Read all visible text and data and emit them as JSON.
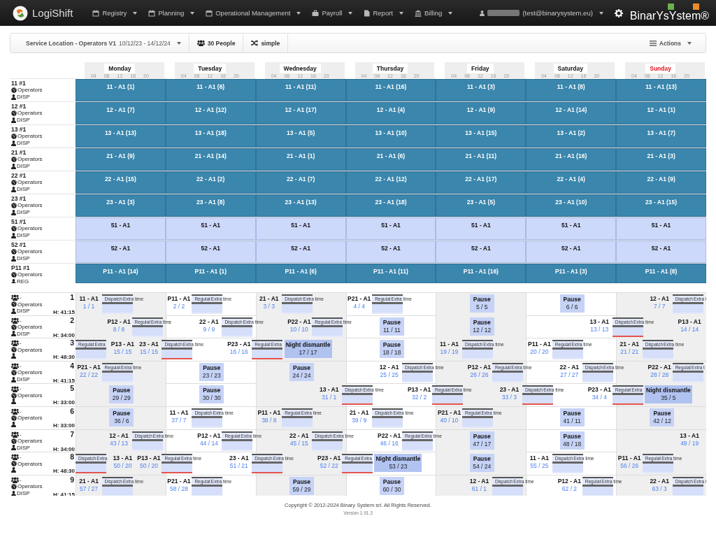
{
  "navbar": {
    "brand": "LogiShift",
    "menus": [
      {
        "label": "Registry",
        "kind": "calendar"
      },
      {
        "label": "Planning",
        "kind": "calendar"
      },
      {
        "label": "Operational Management",
        "kind": "calendar"
      },
      {
        "label": "Payroll",
        "kind": "briefcase"
      },
      {
        "label": "Report",
        "kind": "file"
      },
      {
        "label": "Billing",
        "kind": "bank"
      }
    ],
    "user_email": "(test@binarysystem.eu)",
    "company_logo": "BinarYsYstem®"
  },
  "toolbar": {
    "plan": "Service Location - Operators V1",
    "dates": "10/12/23 - 14/12/24",
    "people": "30 People",
    "mode": "simple",
    "actions": "Actions"
  },
  "days": [
    {
      "label": "Monday",
      "holiday": false,
      "ticks": [
        "04",
        "08",
        "12",
        "16",
        "20"
      ]
    },
    {
      "label": "Tuesday",
      "holiday": false,
      "ticks": [
        "04",
        "08",
        "12",
        "16",
        "20"
      ]
    },
    {
      "label": "Wednesday",
      "holiday": false,
      "ticks": [
        "04",
        "08",
        "12",
        "16",
        "20"
      ]
    },
    {
      "label": "Thursday",
      "holiday": false,
      "ticks": [
        "04",
        "08",
        "12",
        "16",
        "20"
      ]
    },
    {
      "label": "Friday",
      "holiday": false,
      "ticks": [
        "04",
        "08",
        "12",
        "16",
        "20"
      ]
    },
    {
      "label": "Saturday",
      "holiday": false,
      "ticks": [
        "04",
        "08",
        "12",
        "16",
        "20"
      ]
    },
    {
      "label": "Sunday",
      "holiday": true,
      "ticks": [
        "04",
        "08",
        "12",
        "16",
        "20"
      ]
    }
  ],
  "positions": [
    {
      "name": "11 #1",
      "group": "Operators",
      "role": "DISP",
      "cells": [
        {
          "text": "11 - A1 (1)",
          "assigned": true
        },
        {
          "text": "11 - A1 (6)",
          "assigned": true
        },
        {
          "text": "11 - A1 (11)",
          "assigned": true
        },
        {
          "text": "11 - A1 (16)",
          "assigned": true
        },
        {
          "text": "11 - A1 (3)",
          "assigned": true
        },
        {
          "text": "11 - A1 (8)",
          "assigned": true
        },
        {
          "text": "11 - A1 (13)",
          "assigned": true
        }
      ]
    },
    {
      "name": "12 #1",
      "group": "Operators",
      "role": "DISP",
      "cells": [
        {
          "text": "12 - A1 (7)",
          "assigned": true
        },
        {
          "text": "12 - A1 (12)",
          "assigned": true
        },
        {
          "text": "12 - A1 (17)",
          "assigned": true
        },
        {
          "text": "12 - A1 (4)",
          "assigned": true
        },
        {
          "text": "12 - A1 (9)",
          "assigned": true
        },
        {
          "text": "12 - A1 (14)",
          "assigned": true
        },
        {
          "text": "12 - A1 (1)",
          "assigned": true
        }
      ]
    },
    {
      "name": "13 #1",
      "group": "Operators",
      "role": "DISP",
      "cells": [
        {
          "text": "13 - A1 (13)",
          "assigned": true
        },
        {
          "text": "13 - A1 (18)",
          "assigned": true
        },
        {
          "text": "13 - A1 (5)",
          "assigned": true
        },
        {
          "text": "13 - A1 (10)",
          "assigned": true
        },
        {
          "text": "13 - A1 (15)",
          "assigned": true
        },
        {
          "text": "13 - A1 (2)",
          "assigned": true
        },
        {
          "text": "13 - A1 (7)",
          "assigned": true
        }
      ]
    },
    {
      "name": "21 #1",
      "group": "Operators",
      "role": "DISP",
      "cells": [
        {
          "text": "21 - A1 (9)",
          "assigned": true
        },
        {
          "text": "21 - A1 (14)",
          "assigned": true
        },
        {
          "text": "21 - A1 (1)",
          "assigned": true
        },
        {
          "text": "21 - A1 (6)",
          "assigned": true
        },
        {
          "text": "21 - A1 (11)",
          "assigned": true
        },
        {
          "text": "21 - A1 (16)",
          "assigned": true
        },
        {
          "text": "21 - A1 (3)",
          "assigned": true
        }
      ]
    },
    {
      "name": "22 #1",
      "group": "Operators",
      "role": "DISP",
      "cells": [
        {
          "text": "22 - A1 (15)",
          "assigned": true
        },
        {
          "text": "22 - A1 (2)",
          "assigned": true
        },
        {
          "text": "22 - A1 (7)",
          "assigned": true
        },
        {
          "text": "22 - A1 (12)",
          "assigned": true
        },
        {
          "text": "22 - A1 (17)",
          "assigned": true
        },
        {
          "text": "22 - A1 (4)",
          "assigned": true
        },
        {
          "text": "22 - A1 (9)",
          "assigned": true
        }
      ]
    },
    {
      "name": "23 #1",
      "group": "Operators",
      "role": "DISP",
      "cells": [
        {
          "text": "23 - A1 (3)",
          "assigned": true
        },
        {
          "text": "23 - A1 (8)",
          "assigned": true
        },
        {
          "text": "23 - A1 (13)",
          "assigned": true
        },
        {
          "text": "23 - A1 (18)",
          "assigned": true
        },
        {
          "text": "23 - A1 (5)",
          "assigned": true
        },
        {
          "text": "23 - A1 (10)",
          "assigned": true
        },
        {
          "text": "23 - A1 (15)",
          "assigned": true
        }
      ]
    },
    {
      "name": "51 #1",
      "group": "Operators",
      "role": "DISP",
      "cells": [
        {
          "text": "51 - A1",
          "assigned": false
        },
        {
          "text": "51 - A1",
          "assigned": false
        },
        {
          "text": "51 - A1",
          "assigned": false
        },
        {
          "text": "51 - A1",
          "assigned": false
        },
        {
          "text": "51 - A1",
          "assigned": false
        },
        {
          "text": "51 - A1",
          "assigned": false
        },
        {
          "text": "51 - A1",
          "assigned": false
        }
      ]
    },
    {
      "name": "52 #1",
      "group": "Operators",
      "role": "DISP",
      "cells": [
        {
          "text": "52 - A1",
          "assigned": false
        },
        {
          "text": "52 - A1",
          "assigned": false
        },
        {
          "text": "52 - A1",
          "assigned": false
        },
        {
          "text": "52 - A1",
          "assigned": false
        },
        {
          "text": "52 - A1",
          "assigned": false
        },
        {
          "text": "52 - A1",
          "assigned": false
        },
        {
          "text": "52 - A1",
          "assigned": false
        }
      ]
    },
    {
      "name": "P11 #1",
      "group": "Operators",
      "role": "REG",
      "cells": [
        {
          "text": "P11 - A1 (14)",
          "assigned": true
        },
        {
          "text": "P11 - A1 (1)",
          "assigned": true
        },
        {
          "text": "P11 - A1 (6)",
          "assigned": true
        },
        {
          "text": "P11 - A1 (11)",
          "assigned": true
        },
        {
          "text": "P11 - A1 (16)",
          "assigned": true
        },
        {
          "text": "P11 - A1 (3)",
          "assigned": true
        },
        {
          "text": "P11 - A1 (8)",
          "assigned": true
        }
      ]
    }
  ],
  "roster": [
    {
      "team": "-",
      "group": "Operators",
      "role": "DISP",
      "number": "1",
      "hours": "H: 41:15",
      "days": [
        [
          {
            "kind": "early",
            "code": "11 - A1",
            "count": "1 / 1",
            "bar": "Dispatch",
            "extra": "Extra time",
            "overrun": false
          }
        ],
        [
          {
            "kind": "early",
            "code": "P11 - A1",
            "count": "2 / 2",
            "bar": "Regulat",
            "extra": "Extra time",
            "overrun": false
          }
        ],
        [
          {
            "kind": "early",
            "code": "21 - A1",
            "count": "3 / 3",
            "bar": "Dispatch",
            "extra": "Extra time",
            "overrun": false
          }
        ],
        [
          {
            "kind": "early",
            "code": "P21 - A1",
            "count": "4 / 4",
            "bar": "Regulat",
            "extra": "Extra time",
            "overrun": false
          }
        ],
        [
          {
            "kind": "pause",
            "title": "Pause",
            "count": "5 / 5"
          }
        ],
        [
          {
            "kind": "pause",
            "title": "Pause",
            "count": "6 / 6"
          }
        ],
        [
          {
            "kind": "late",
            "code": "12 - A1",
            "count": "7 / 7",
            "bar": "Dispatch",
            "extra": "Extra t",
            "overrun": false
          }
        ]
      ]
    },
    {
      "team": "-",
      "group": "Operators",
      "role": "DISP",
      "number": "2",
      "hours": "H: 34:00",
      "days": [
        [
          {
            "kind": "late",
            "code": "P12 - A1",
            "count": "8 / 8",
            "bar": "Regulat",
            "extra": "Extra time",
            "overrun": false
          }
        ],
        [
          {
            "kind": "late",
            "code": "22 - A1",
            "count": "9 / 9",
            "bar": "Dispatch",
            "extra": "Extra time",
            "overrun": false
          }
        ],
        [
          {
            "kind": "late",
            "code": "P22 - A1",
            "count": "10 / 10",
            "bar": "Regulat",
            "extra": "Extra time",
            "overrun": false
          }
        ],
        [
          {
            "kind": "pause",
            "title": "Pause",
            "count": "11 / 11"
          }
        ],
        [
          {
            "kind": "pause",
            "title": "Pause",
            "count": "12 / 12"
          }
        ],
        [
          {
            "kind": "night",
            "code": "13 - A1",
            "count": "13 / 13",
            "bar": "Dispatch",
            "extra": "Extra time",
            "overrun": true
          }
        ],
        [
          {
            "kind": "tag",
            "code": "P13 - A1",
            "count": "14 / 14"
          }
        ]
      ]
    },
    {
      "team": "-",
      "group": "Operators",
      "number": "3",
      "hours": "H: 48:30",
      "days": [
        [
          {
            "kind": "carry",
            "bar": "Regulat",
            "extra": "Extra",
            "overrun": false
          },
          {
            "kind": "tag-mid",
            "code": "P13 - A1",
            "count": "15 / 15"
          },
          {
            "kind": "night",
            "code": "23 - A1",
            "count": "15 / 15",
            "bar": "Dispatch",
            "extra": "Extra time",
            "overrun": true
          }
        ],
        [
          {
            "kind": "night",
            "code": "P23 - A1",
            "count": "16 / 16",
            "bar": "Regulat",
            "extra": "Extra",
            "overrun": true
          }
        ],
        [
          {
            "kind": "dismantle",
            "title": "Night dismantle",
            "count": "17 / 17"
          }
        ],
        [
          {
            "kind": "pause",
            "title": "Pause",
            "count": "18 / 18"
          }
        ],
        [
          {
            "kind": "early",
            "code": "11 - A1",
            "count": "19 / 19",
            "bar": "Dispatch",
            "extra": "Extra time",
            "overrun": false
          }
        ],
        [
          {
            "kind": "early",
            "code": "P11 - A1",
            "count": "20 / 20",
            "bar": "Regulat",
            "extra": "Extra time",
            "overrun": false
          }
        ],
        [
          {
            "kind": "early",
            "code": "21 - A1",
            "count": "21 / 21",
            "bar": "Dispatch",
            "extra": "Extra time",
            "overrun": false
          }
        ]
      ]
    },
    {
      "team": "-",
      "group": "Operators",
      "role": "DISP",
      "number": "4",
      "hours": "H: 41:15",
      "days": [
        [
          {
            "kind": "early",
            "code": "P21 - A1",
            "count": "22 / 22",
            "bar": "Regulat",
            "extra": "Extra time",
            "overrun": false
          }
        ],
        [
          {
            "kind": "pause",
            "title": "Pause",
            "count": "23 / 23"
          }
        ],
        [
          {
            "kind": "pause",
            "title": "Pause",
            "count": "24 / 24"
          }
        ],
        [
          {
            "kind": "late",
            "code": "12 - A1",
            "count": "25 / 25",
            "bar": "Dispatch",
            "extra": "Extra time",
            "overrun": false
          }
        ],
        [
          {
            "kind": "late",
            "code": "P12 - A1",
            "count": "26 / 26",
            "bar": "Regulat",
            "extra": "Extra time",
            "overrun": false
          }
        ],
        [
          {
            "kind": "late",
            "code": "22 - A1",
            "count": "27 / 27",
            "bar": "Dispatch",
            "extra": "Extra time",
            "overrun": false
          }
        ],
        [
          {
            "kind": "late",
            "code": "P22 - A1",
            "count": "28 / 28",
            "bar": "Regulat",
            "extra": "Extra t",
            "overrun": false
          }
        ]
      ]
    },
    {
      "team": "-",
      "group": "Operators",
      "number": "5",
      "hours": "H: 33:00",
      "days": [
        [
          {
            "kind": "pause",
            "title": "Pause",
            "count": "29 / 29"
          }
        ],
        [
          {
            "kind": "pause",
            "title": "Pause",
            "count": "30 / 30"
          }
        ],
        [
          {
            "kind": "night",
            "code": "13 - A1",
            "count": "31 / 1",
            "bar": "Dispatch",
            "extra": "Extra time",
            "overrun": true
          }
        ],
        [
          {
            "kind": "night",
            "code": "P13 - A1",
            "count": "32 / 2",
            "bar": "Regulat",
            "extra": "Extra time",
            "overrun": true
          }
        ],
        [
          {
            "kind": "night",
            "code": "23 - A1",
            "count": "33 / 3",
            "bar": "Dispatch",
            "extra": "Extra time",
            "overrun": true
          }
        ],
        [
          {
            "kind": "night",
            "code": "P23 - A1",
            "count": "34 / 4",
            "bar": "Regulat",
            "extra": "Extra",
            "overrun": true
          }
        ],
        [
          {
            "kind": "dismantle",
            "title": "Night dismantle",
            "count": "35 / 5"
          }
        ]
      ]
    },
    {
      "team": "-",
      "group": "Operators",
      "number": "6",
      "hours": "H: 33:00",
      "days": [
        [
          {
            "kind": "pause",
            "title": "Pause",
            "count": "36 / 6"
          }
        ],
        [
          {
            "kind": "early",
            "code": "11 - A1",
            "count": "37 / 7",
            "bar": "Dispatch",
            "extra": "Extra time",
            "overrun": false
          }
        ],
        [
          {
            "kind": "early",
            "code": "P11 - A1",
            "count": "38 / 8",
            "bar": "Regulat",
            "extra": "Extra time",
            "overrun": false
          }
        ],
        [
          {
            "kind": "early",
            "code": "21 - A1",
            "count": "39 / 9",
            "bar": "Dispatch",
            "extra": "Extra time",
            "overrun": false
          }
        ],
        [
          {
            "kind": "early",
            "code": "P21 - A1",
            "count": "40 / 10",
            "bar": "Regulat",
            "extra": "Extra time",
            "overrun": false
          }
        ],
        [
          {
            "kind": "pause",
            "title": "Pause",
            "count": "41 / 11"
          }
        ],
        [
          {
            "kind": "pause",
            "title": "Pause",
            "count": "42 / 12"
          }
        ]
      ]
    },
    {
      "team": "-",
      "group": "Operators",
      "role": "DISP",
      "number": "7",
      "hours": "H: 34:00",
      "days": [
        [
          {
            "kind": "late",
            "code": "12 - A1",
            "count": "43 / 13",
            "bar": "Dispatch",
            "extra": "Extra time",
            "overrun": false
          }
        ],
        [
          {
            "kind": "late",
            "code": "P12 - A1",
            "count": "44 / 14",
            "bar": "Regulat",
            "extra": "Extra time",
            "overrun": false
          }
        ],
        [
          {
            "kind": "late",
            "code": "22 - A1",
            "count": "45 / 15",
            "bar": "Dispatch",
            "extra": "Extra time",
            "overrun": false
          }
        ],
        [
          {
            "kind": "late",
            "code": "P22 - A1",
            "count": "46 / 16",
            "bar": "Regulat",
            "extra": "Extra time",
            "overrun": false
          }
        ],
        [
          {
            "kind": "pause",
            "title": "Pause",
            "count": "47 / 17"
          }
        ],
        [
          {
            "kind": "pause",
            "title": "Pause",
            "count": "48 / 18"
          }
        ],
        [
          {
            "kind": "tag",
            "code": "13 - A1",
            "count": "49 / 19"
          }
        ]
      ]
    },
    {
      "team": "-",
      "group": "Operators",
      "number": "8",
      "hours": "H: 48:30",
      "days": [
        [
          {
            "kind": "carry",
            "bar": "Dispatch",
            "extra": "Extra",
            "overrun": true
          },
          {
            "kind": "tag-mid",
            "code": "13 - A1",
            "count": "50 / 20"
          },
          {
            "kind": "night",
            "code": "P13 - A1",
            "count": "50 / 20",
            "bar": "Regulat",
            "extra": "Extra time",
            "overrun": true
          }
        ],
        [
          {
            "kind": "night",
            "code": "23 - A1",
            "count": "51 / 21",
            "bar": "Dispatch",
            "extra": "Extra time",
            "overrun": true
          }
        ],
        [
          {
            "kind": "night",
            "code": "P23 - A1",
            "count": "52 / 22",
            "bar": "Regulat",
            "extra": "Extra",
            "overrun": true
          }
        ],
        [
          {
            "kind": "dismantle",
            "title": "Night dismantle",
            "count": "53 / 23"
          }
        ],
        [
          {
            "kind": "pause",
            "title": "Pause",
            "count": "54 / 24"
          }
        ],
        [
          {
            "kind": "early",
            "code": "11 - A1",
            "count": "55 / 25",
            "bar": "Dispatch",
            "extra": "Extra time",
            "overrun": false
          }
        ],
        [
          {
            "kind": "early",
            "code": "P11 - A1",
            "count": "56 / 26",
            "bar": "Regulat",
            "extra": "Extra time",
            "overrun": false
          }
        ]
      ]
    },
    {
      "team": "-",
      "group": "Operators",
      "role": "DISP",
      "number": "9",
      "hours": "H: 41:15",
      "days": [
        [
          {
            "kind": "early",
            "code": "21 - A1",
            "count": "57 / 27",
            "bar": "Dispatch",
            "extra": "Extra time",
            "overrun": false
          }
        ],
        [
          {
            "kind": "early",
            "code": "P21 - A1",
            "count": "58 / 28",
            "bar": "Regulat",
            "extra": "Extra time",
            "overrun": false
          }
        ],
        [
          {
            "kind": "pause",
            "title": "Pause",
            "count": "59 / 29"
          }
        ],
        [
          {
            "kind": "pause",
            "title": "Pause",
            "count": "60 / 30"
          }
        ],
        [
          {
            "kind": "late",
            "code": "12 - A1",
            "count": "61 / 1",
            "bar": "Dispatch",
            "extra": "Extra time",
            "overrun": false
          }
        ],
        [
          {
            "kind": "late",
            "code": "P12 - A1",
            "count": "62 / 2",
            "bar": "Regulat",
            "extra": "Extra time",
            "overrun": false
          }
        ],
        [
          {
            "kind": "late",
            "code": "22 - A1",
            "count": "63 / 3",
            "bar": "Dispatch",
            "extra": "Extra t",
            "overrun": false
          }
        ]
      ]
    }
  ],
  "footer": {
    "copyright": "Copyright © 2012-2024 Binary System srl. All Rights Reserved.",
    "version": "Version 1.91.3"
  }
}
